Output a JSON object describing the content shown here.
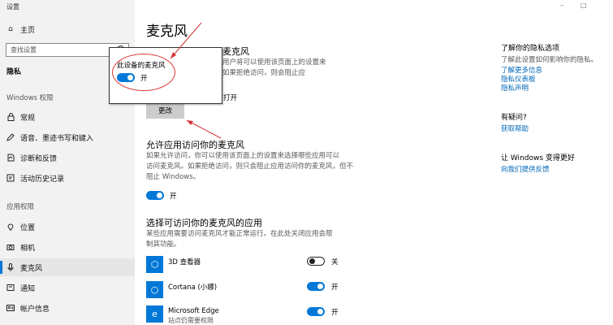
{
  "window": {
    "title": "设置",
    "controls": [
      "–",
      "□"
    ]
  },
  "sidebar": {
    "home": "主页",
    "search_placeholder": "查找设置",
    "category": "隐私",
    "section_windows": "Windows 权限",
    "windows_items": [
      {
        "icon": "lock-icon",
        "label": "常规"
      },
      {
        "icon": "pen-icon",
        "label": "语音、墨迹书写和键入"
      },
      {
        "icon": "diagnostics-icon",
        "label": "诊断和反馈"
      },
      {
        "icon": "history-icon",
        "label": "活动历史记录"
      }
    ],
    "section_apps": "应用权限",
    "app_items": [
      {
        "icon": "location-icon",
        "label": "位置"
      },
      {
        "icon": "camera-icon",
        "label": "相机"
      },
      {
        "icon": "microphone-icon",
        "label": "麦克风",
        "active": true
      },
      {
        "icon": "notification-icon",
        "label": "通知"
      },
      {
        "icon": "account-icon",
        "label": "帐户信息"
      }
    ]
  },
  "main": {
    "title": "麦克风",
    "section1": {
      "heading_partial": "麦克风",
      "desc_line1": "用户将可以使用该页面上的设置来",
      "desc_line2": "如果拒绝访问，则会阻止应",
      "status_partial": "打开",
      "change_button": "更改"
    },
    "section2": {
      "heading": "允许应用访问你的麦克风",
      "desc_line1": "如果允许访问，你可以使用该页面上的设置来选择哪些应用可以",
      "desc_line2": "访问麦克风。如果拒绝访问，则只会阻止应用访问你的麦克风，但不",
      "desc_line3": "阻止 Windows。",
      "toggle_label": "开",
      "toggle_on": true
    },
    "section3": {
      "heading": "选择可访问你的麦克风的应用",
      "desc_line1": "某些应用需要访问麦克风才能正常运行。在此处关闭应用会限",
      "desc_line2": "制其功能。",
      "apps": [
        {
          "icon": "3d-viewer-icon",
          "glyph": "⬡",
          "name": "3D 查看器",
          "sub": "",
          "toggle_on": false,
          "toggle_label": "关"
        },
        {
          "icon": "cortana-icon",
          "glyph": "○",
          "name": "Cortana (小娜)",
          "sub": "",
          "toggle_on": true,
          "toggle_label": "开"
        },
        {
          "icon": "edge-icon",
          "glyph": "e",
          "name": "Microsoft Edge",
          "sub": "站点仍需要权限",
          "toggle_on": true,
          "toggle_label": "开"
        }
      ]
    }
  },
  "popup": {
    "title": "此设备的麦克风",
    "toggle_label": "开",
    "toggle_on": true
  },
  "right": {
    "privacy_heading": "了解你的隐私选项",
    "privacy_desc": "了解此设置如何影响你的隐私。",
    "links1": [
      "了解更多信息",
      "隐私仪表板",
      "隐私声明"
    ],
    "question_heading": "有疑问?",
    "help_link": "获取帮助",
    "improve_heading": "让 Windows 变得更好",
    "feedback_link": "向我们提供反馈"
  },
  "colors": {
    "accent": "#0078d7",
    "link": "#0067b8",
    "annotation": "#d33333"
  }
}
